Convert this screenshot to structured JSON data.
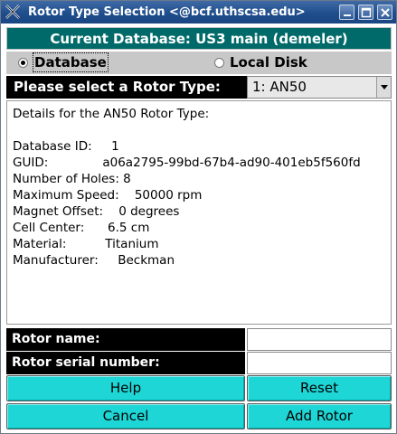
{
  "window": {
    "title": "Rotor Type Selection <@bcf.uthscsa.edu>"
  },
  "banner": {
    "text": "Current Database: US3 main (demeler)"
  },
  "source": {
    "database_label": "Database",
    "local_disk_label": "Local Disk",
    "selected": "Database"
  },
  "rotor_select": {
    "label": "Please select a Rotor Type:",
    "selected": "1: AN50"
  },
  "details": {
    "heading": "Details for the AN50 Rotor Type:",
    "lines": [
      "Database ID:     1",
      "GUID:              a06a2795-99bd-67b4-ad90-401eb5f560fd",
      "Number of Holes: 8",
      "Maximum Speed:    50000 rpm",
      "Magnet Offset:    0 degrees",
      "Cell Center:      6.5 cm",
      "Material:          Titanium",
      "Manufacturer:     Beckman"
    ]
  },
  "form": {
    "rotor_name_label": "Rotor name:",
    "rotor_name_value": "",
    "rotor_serial_label": "Rotor serial number:",
    "rotor_serial_value": ""
  },
  "buttons": {
    "help": "Help",
    "reset": "Reset",
    "cancel": "Cancel",
    "add_rotor": "Add Rotor"
  },
  "colors": {
    "banner_bg": "#006a6a",
    "button_bg": "#1fd6d6",
    "label_bg": "#000000"
  }
}
